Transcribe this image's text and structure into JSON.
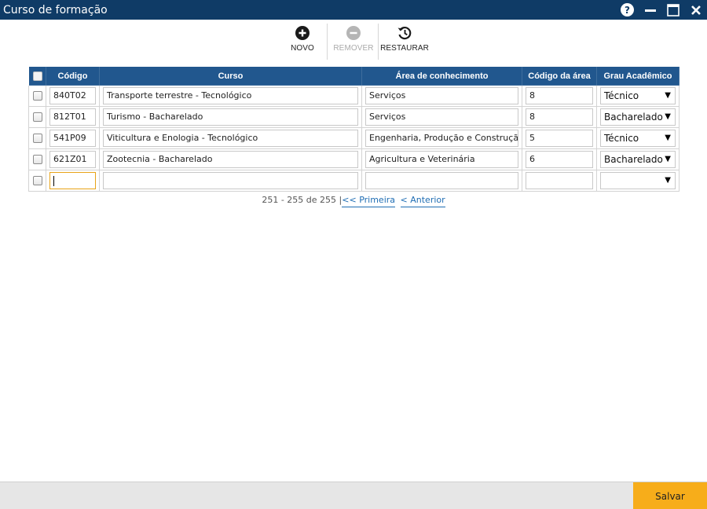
{
  "window": {
    "title": "Curso de formação",
    "help_label": "?"
  },
  "toolbar": {
    "new_label": "NOVO",
    "remove_label": "REMOVER",
    "restore_label": "RESTAURAR"
  },
  "table": {
    "headers": {
      "codigo": "Código",
      "curso": "Curso",
      "area": "Área de conhecimento",
      "codigo_area": "Código da área",
      "grau": "Grau Acadêmico"
    },
    "rows": [
      {
        "codigo": "840T02",
        "curso": "Transporte terrestre - Tecnológico",
        "area": "Serviços",
        "codigo_area": "8",
        "grau": "Técnico"
      },
      {
        "codigo": "812T01",
        "curso": "Turismo - Bacharelado",
        "area": "Serviços",
        "codigo_area": "8",
        "grau": "Bacharelado"
      },
      {
        "codigo": "541P09",
        "curso": "Viticultura e Enologia  - Tecnológico",
        "area": "Engenharia, Produção e Construção",
        "codigo_area": "5",
        "grau": "Técnico"
      },
      {
        "codigo": "621Z01",
        "curso": "Zootecnia - Bacharelado",
        "area": "Agricultura e Veterinária",
        "codigo_area": "6",
        "grau": "Bacharelado"
      }
    ]
  },
  "pager": {
    "range": "251 - 255 de 255",
    "first_label": "<< Primeira",
    "prev_label": "< Anterior",
    "separator": "|"
  },
  "footer": {
    "save_label": "Salvar"
  },
  "colors": {
    "titlebar": "#0f3b66",
    "header": "#21578e",
    "accent": "#f7ad1a",
    "link": "#1f6db3"
  }
}
